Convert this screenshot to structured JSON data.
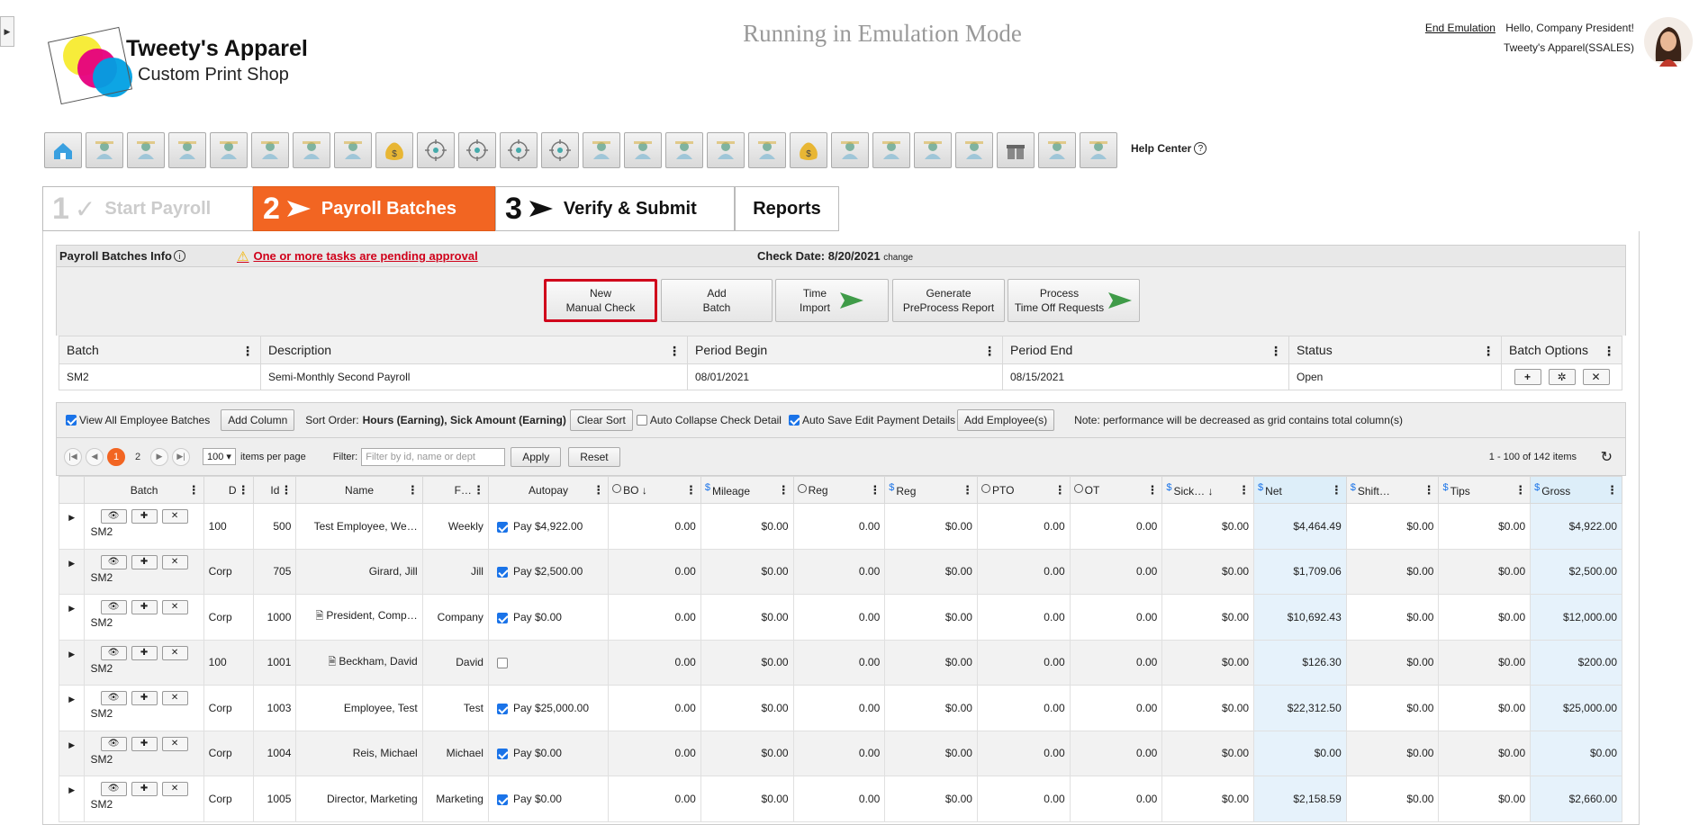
{
  "header": {
    "logo_line1": "Tweety's Apparel",
    "logo_line2": "Custom Print Shop",
    "emulation_title": "Running in Emulation Mode",
    "end_emulation": "End Emulation",
    "greeting": "Hello, Company President!",
    "company": "Tweety's Apparel(SSALES)",
    "help_center": "Help Center"
  },
  "toolbar_icons": [
    "home-icon",
    "target-icon",
    "people-gear-icon",
    "presentation-icon",
    "group-icon",
    "team-board-icon",
    "org-chart-icon",
    "document-icon",
    "money-bag-icon",
    "crosshair-icon",
    "crosshair-icon",
    "crosshair-icon",
    "crosshair-icon",
    "tools-icon",
    "person-chart-icon",
    "shield-money-icon",
    "hand-search-icon",
    "search-x-icon",
    "money-bag-icon",
    "team-chart-icon",
    "person-presenting-icon",
    "coins-icon",
    "hand-coin-icon",
    "gift-icon",
    "team-board-icon",
    "hand-search-icon"
  ],
  "steps": [
    {
      "num": "1",
      "label": "Start Payroll"
    },
    {
      "num": "2",
      "label": "Payroll Batches"
    },
    {
      "num": "3",
      "label": "Verify & Submit"
    },
    {
      "num": "",
      "label": "Reports"
    }
  ],
  "batches_info": {
    "title": "Payroll Batches Info",
    "pending": "One or more tasks are pending approval",
    "check_date": "Check Date: 8/20/2021",
    "change": "change"
  },
  "actions": {
    "new_manual_1": "New",
    "new_manual_2": "Manual Check",
    "add_batch_1": "Add",
    "add_batch_2": "Batch",
    "time_import_1": "Time",
    "time_import_2": "Import",
    "gen_report_1": "Generate",
    "gen_report_2": "PreProcess Report",
    "process_1": "Process",
    "process_2": "Time Off Requests"
  },
  "batch_table": {
    "headers": [
      "Batch",
      "Description",
      "Period Begin",
      "Period End",
      "Status",
      "Batch Options"
    ],
    "row": [
      "SM2",
      "Semi-Monthly Second Payroll",
      "08/01/2021",
      "08/15/2021",
      "Open"
    ]
  },
  "grid_toolbar": {
    "view_all": "View All Employee Batches",
    "add_column": "Add Column",
    "sort_prefix": "Sort Order:",
    "sort_value": "Hours (Earning), Sick Amount (Earning)",
    "clear_sort": "Clear Sort",
    "auto_collapse": "Auto Collapse Check Detail",
    "auto_save": "Auto Save Edit Payment Details",
    "add_employee": "Add Employee(s)",
    "note": "Note: performance will be decreased as grid contains total column(s)"
  },
  "pager": {
    "page1": "1",
    "page2": "2",
    "per_page": "100",
    "per_page_label": "items per page",
    "filter_label": "Filter:",
    "filter_placeholder": "Filter by id, name or dept",
    "apply": "Apply",
    "reset": "Reset",
    "range": "1 - 100 of 142 items"
  },
  "grid": {
    "columns": [
      "Batch",
      "D",
      "Id",
      "Name",
      "F…",
      "Autopay",
      "BO",
      "Mileage",
      "Reg",
      "Reg",
      "PTO",
      "OT",
      "Sick…",
      "Net",
      "Shift…",
      "Tips",
      "Gross"
    ],
    "rows": [
      {
        "batch": "SM2",
        "d": "100",
        "id": "500",
        "name": "Test Employee, We…",
        "doc": false,
        "f": "Weekly",
        "autopay": true,
        "pay": "Pay $4,922.00",
        "bo": "0.00",
        "mileage": "$0.00",
        "reg_h": "0.00",
        "reg_a": "$0.00",
        "pto": "0.00",
        "ot": "0.00",
        "sick": "$0.00",
        "net": "$4,464.49",
        "shift": "$0.00",
        "tips": "$0.00",
        "gross": "$4,922.00"
      },
      {
        "batch": "SM2",
        "d": "Corp",
        "id": "705",
        "name": "Girard, Jill",
        "doc": false,
        "f": "Jill",
        "autopay": true,
        "pay": "Pay $2,500.00",
        "bo": "0.00",
        "mileage": "$0.00",
        "reg_h": "0.00",
        "reg_a": "$0.00",
        "pto": "0.00",
        "ot": "0.00",
        "sick": "$0.00",
        "net": "$1,709.06",
        "shift": "$0.00",
        "tips": "$0.00",
        "gross": "$2,500.00"
      },
      {
        "batch": "SM2",
        "d": "Corp",
        "id": "1000",
        "name": "President, Comp…",
        "doc": true,
        "f": "Company",
        "autopay": true,
        "pay": "Pay $0.00",
        "bo": "0.00",
        "mileage": "$0.00",
        "reg_h": "0.00",
        "reg_a": "$0.00",
        "pto": "0.00",
        "ot": "0.00",
        "sick": "$0.00",
        "net": "$10,692.43",
        "shift": "$0.00",
        "tips": "$0.00",
        "gross": "$12,000.00"
      },
      {
        "batch": "SM2",
        "d": "100",
        "id": "1001",
        "name": "Beckham, David",
        "doc": true,
        "f": "David",
        "autopay": false,
        "pay": "",
        "bo": "0.00",
        "mileage": "$0.00",
        "reg_h": "0.00",
        "reg_a": "$0.00",
        "pto": "0.00",
        "ot": "0.00",
        "sick": "$0.00",
        "net": "$126.30",
        "shift": "$0.00",
        "tips": "$0.00",
        "gross": "$200.00"
      },
      {
        "batch": "SM2",
        "d": "Corp",
        "id": "1003",
        "name": "Employee, Test",
        "doc": false,
        "f": "Test",
        "autopay": true,
        "pay": "Pay $25,000.00",
        "bo": "0.00",
        "mileage": "$0.00",
        "reg_h": "0.00",
        "reg_a": "$0.00",
        "pto": "0.00",
        "ot": "0.00",
        "sick": "$0.00",
        "net": "$22,312.50",
        "shift": "$0.00",
        "tips": "$0.00",
        "gross": "$25,000.00"
      },
      {
        "batch": "SM2",
        "d": "Corp",
        "id": "1004",
        "name": "Reis, Michael",
        "doc": false,
        "f": "Michael",
        "autopay": true,
        "pay": "Pay $0.00",
        "bo": "0.00",
        "mileage": "$0.00",
        "reg_h": "0.00",
        "reg_a": "$0.00",
        "pto": "0.00",
        "ot": "0.00",
        "sick": "$0.00",
        "net": "$0.00",
        "shift": "$0.00",
        "tips": "$0.00",
        "gross": "$0.00"
      },
      {
        "batch": "SM2",
        "d": "Corp",
        "id": "1005",
        "name": "Director, Marketing",
        "doc": false,
        "f": "Marketing",
        "autopay": true,
        "pay": "Pay $0.00",
        "bo": "0.00",
        "mileage": "$0.00",
        "reg_h": "0.00",
        "reg_a": "$0.00",
        "pto": "0.00",
        "ot": "0.00",
        "sick": "$0.00",
        "net": "$2,158.59",
        "shift": "$0.00",
        "tips": "$0.00",
        "gross": "$2,660.00"
      }
    ]
  },
  "colors": {
    "accent": "#f26522",
    "alert": "#d0021b",
    "net_bg": "#e6f2fb"
  }
}
